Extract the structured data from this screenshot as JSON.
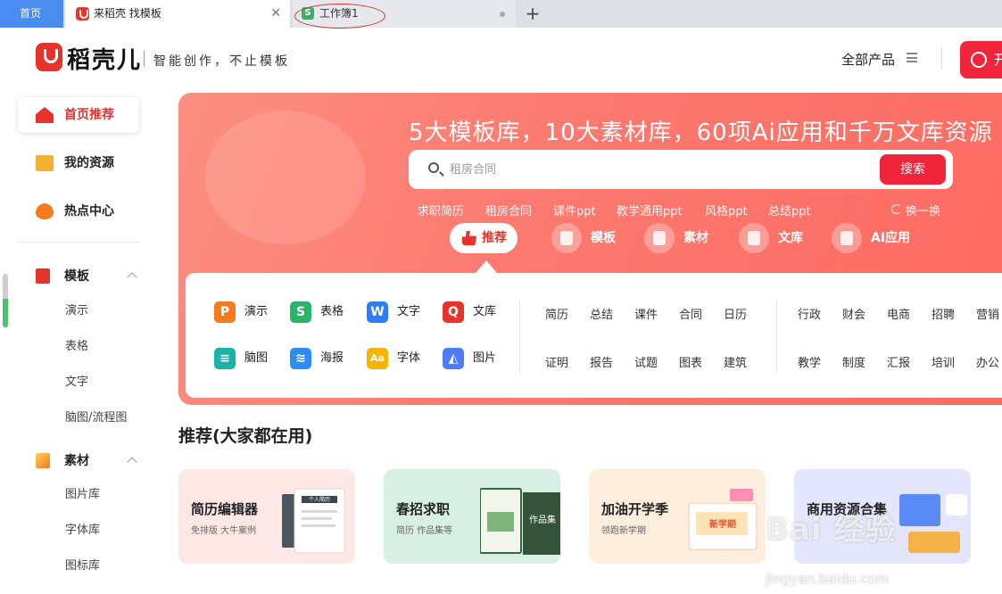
{
  "tabs": {
    "home": "首页",
    "active_title": "来稻壳 找模板",
    "close_glyph": "✕",
    "second_title": "工作簿1",
    "second_icon_letter": "S",
    "new_glyph": "+"
  },
  "header": {
    "brand": "稻壳儿",
    "slogan": "智能创作，不止模板",
    "all_products": "全部产品",
    "cta_label": "开"
  },
  "sidebar": {
    "nav": [
      {
        "label": "首页推荐"
      },
      {
        "label": "我的资源"
      },
      {
        "label": "热点中心"
      }
    ],
    "template_section": "模板",
    "template_items": [
      "演示",
      "表格",
      "文字",
      "脑图/流程图"
    ],
    "material_section": "素材",
    "material_items": [
      "图片库",
      "字体库",
      "图标库"
    ]
  },
  "banner": {
    "title": "5大模板库，10大素材库，60项Ai应用和千万文库资源",
    "search_placeholder": "租房合同",
    "search_button": "搜索",
    "hot_tags": [
      "求职简历",
      "租房合同",
      "课件ppt",
      "教学通用ppt",
      "风格ppt",
      "总结ppt"
    ],
    "refresh": "换一换",
    "categories": [
      {
        "label": "推荐",
        "active": true
      },
      {
        "label": "模板",
        "active": false
      },
      {
        "label": "素材",
        "active": false
      },
      {
        "label": "文库",
        "active": false
      },
      {
        "label": "AI应用",
        "active": false
      }
    ]
  },
  "apps": {
    "row1": [
      {
        "label": "演示",
        "icon": "P",
        "color": "#f57a1c"
      },
      {
        "label": "表格",
        "icon": "S",
        "color": "#2bb36a"
      },
      {
        "label": "文字",
        "icon": "W",
        "color": "#2e7cf6"
      },
      {
        "label": "文库",
        "icon": "Q",
        "color": "#e8322c"
      }
    ],
    "row2": [
      {
        "label": "脑图",
        "icon": "≡",
        "color": "#19b3a8"
      },
      {
        "label": "海报",
        "icon": "≋",
        "color": "#2e8cf6"
      },
      {
        "label": "字体",
        "icon": "Aa",
        "color": "#f6b400"
      },
      {
        "label": "图片",
        "icon": "◭",
        "color": "#4e7cf6"
      }
    ],
    "col2_row1": [
      "简历",
      "总结",
      "课件",
      "合同",
      "日历"
    ],
    "col2_row2": [
      "证明",
      "报告",
      "试题",
      "图表",
      "建筑"
    ],
    "col3_row1": [
      "行政",
      "财会",
      "电商",
      "招聘",
      "营销"
    ],
    "col3_row2": [
      "教学",
      "制度",
      "汇报",
      "培训",
      "办公"
    ]
  },
  "recommend": {
    "heading": "推荐(大家都在用)",
    "cards": [
      {
        "title": "简历编辑器",
        "sub": "免排版 大牛案例",
        "bg": "#fde8e6",
        "art_text": "个人简历"
      },
      {
        "title": "春招求职",
        "sub": "简历 作品集等",
        "bg": "#d8f0e4",
        "art_text": "作品集"
      },
      {
        "title": "加油开学季",
        "sub": "领跑新学期",
        "bg": "#fdeedd",
        "art_text": "新学期"
      },
      {
        "title": "商用资源合集",
        "sub": "",
        "bg": "#e4e6fb",
        "art_text": ""
      }
    ]
  },
  "watermark": {
    "text": "Bai 经验",
    "url": "jingyan.baidu.com"
  },
  "colors": {
    "accent": "#e8322c",
    "button_red": "#f0243a",
    "banner_start": "#fb8f80",
    "banner_end": "#fd6a60"
  }
}
